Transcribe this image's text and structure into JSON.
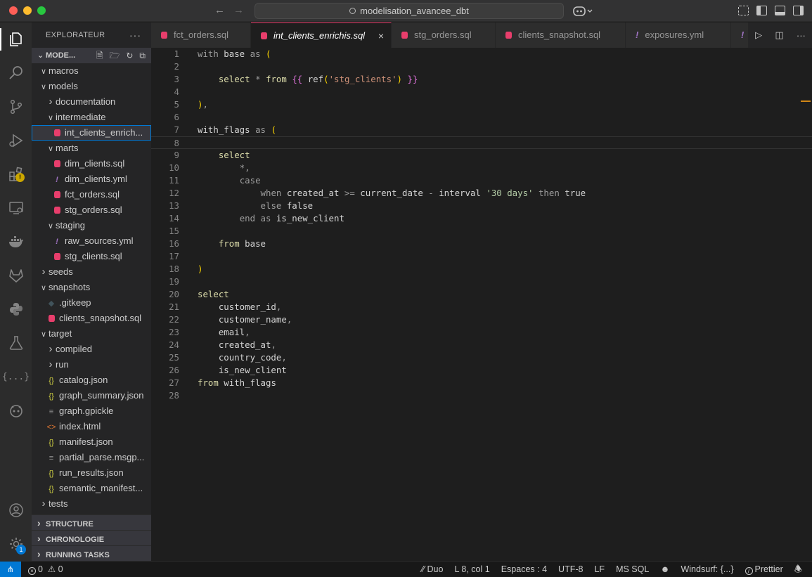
{
  "titlebar": {
    "search_text": "modelisation_avancee_dbt"
  },
  "sidebar": {
    "title": "EXPLORATEUR",
    "project_label": "MODE...",
    "tree": [
      {
        "depth": 1,
        "type": "folder",
        "open": true,
        "label": "macros"
      },
      {
        "depth": 1,
        "type": "folder",
        "open": true,
        "label": "models"
      },
      {
        "depth": 2,
        "type": "folder",
        "open": false,
        "label": "documentation"
      },
      {
        "depth": 2,
        "type": "folder",
        "open": true,
        "label": "intermediate"
      },
      {
        "depth": 3,
        "type": "sql",
        "label": "int_clients_enrich...",
        "selected": true
      },
      {
        "depth": 2,
        "type": "folder",
        "open": true,
        "label": "marts"
      },
      {
        "depth": 3,
        "type": "sql",
        "label": "dim_clients.sql"
      },
      {
        "depth": 3,
        "type": "yml",
        "label": "dim_clients.yml"
      },
      {
        "depth": 3,
        "type": "sql",
        "label": "fct_orders.sql"
      },
      {
        "depth": 3,
        "type": "sql",
        "label": "stg_orders.sql"
      },
      {
        "depth": 2,
        "type": "folder",
        "open": true,
        "label": "staging"
      },
      {
        "depth": 3,
        "type": "yml",
        "label": "raw_sources.yml"
      },
      {
        "depth": 3,
        "type": "sql",
        "label": "stg_clients.sql"
      },
      {
        "depth": 1,
        "type": "folder",
        "open": false,
        "label": "seeds"
      },
      {
        "depth": 1,
        "type": "folder",
        "open": true,
        "label": "snapshots"
      },
      {
        "depth": 2,
        "type": "git",
        "label": ".gitkeep"
      },
      {
        "depth": 2,
        "type": "sql",
        "label": "clients_snapshot.sql"
      },
      {
        "depth": 1,
        "type": "folder",
        "open": true,
        "label": "target"
      },
      {
        "depth": 2,
        "type": "folder",
        "open": false,
        "label": "compiled"
      },
      {
        "depth": 2,
        "type": "folder",
        "open": false,
        "label": "run"
      },
      {
        "depth": 2,
        "type": "json",
        "label": "catalog.json"
      },
      {
        "depth": 2,
        "type": "json",
        "label": "graph_summary.json"
      },
      {
        "depth": 2,
        "type": "txt",
        "label": "graph.gpickle"
      },
      {
        "depth": 2,
        "type": "html",
        "label": "index.html"
      },
      {
        "depth": 2,
        "type": "json",
        "label": "manifest.json"
      },
      {
        "depth": 2,
        "type": "txt",
        "label": "partial_parse.msgp..."
      },
      {
        "depth": 2,
        "type": "json",
        "label": "run_results.json"
      },
      {
        "depth": 2,
        "type": "json",
        "label": "semantic_manifest..."
      },
      {
        "depth": 1,
        "type": "folder",
        "open": false,
        "label": "tests"
      }
    ],
    "bottom_sections": [
      "STRUCTURE",
      "CHRONOLOGIE",
      "RUNNING TASKS"
    ]
  },
  "activity": {
    "warning_badge": "!",
    "settings_badge": "1"
  },
  "tabs": [
    {
      "label": "fct_orders.sql",
      "icon": "sql"
    },
    {
      "label": "int_clients_enrichis.sql",
      "icon": "sql",
      "active": true
    },
    {
      "label": "stg_orders.sql",
      "icon": "sql"
    },
    {
      "label": "clients_snapshot.sql",
      "icon": "sql"
    },
    {
      "label": "exposures.yml",
      "icon": "yml"
    }
  ],
  "editor": {
    "current_line": 8,
    "lines": [
      "with base as (",
      "",
      "    select * from {{ ref('stg_clients') }}",
      "",
      "),",
      "",
      "with_flags as (",
      "",
      "    select",
      "        *,",
      "        case",
      "            when created_at >= current_date - interval '30 days' then true",
      "            else false",
      "        end as is_new_client",
      "",
      "    from base",
      "",
      ")",
      "",
      "select",
      "    customer_id,",
      "    customer_name,",
      "    email,",
      "    created_at,",
      "    country_code,",
      "    is_new_client",
      "from with_flags",
      ""
    ]
  },
  "statusbar": {
    "errors": "0",
    "warnings": "0",
    "duo": "Duo",
    "position": "L 8, col 1",
    "spaces": "Espaces : 4",
    "encoding": "UTF-8",
    "eol": "LF",
    "language": "MS SQL",
    "windsurf": "Windsurf: {...}",
    "prettier": "Prettier"
  },
  "colors": {
    "accent": "#0078d4",
    "sql_icon": "#e83e6c",
    "yml_icon": "#a074c4",
    "json_icon": "#cbcb41"
  }
}
